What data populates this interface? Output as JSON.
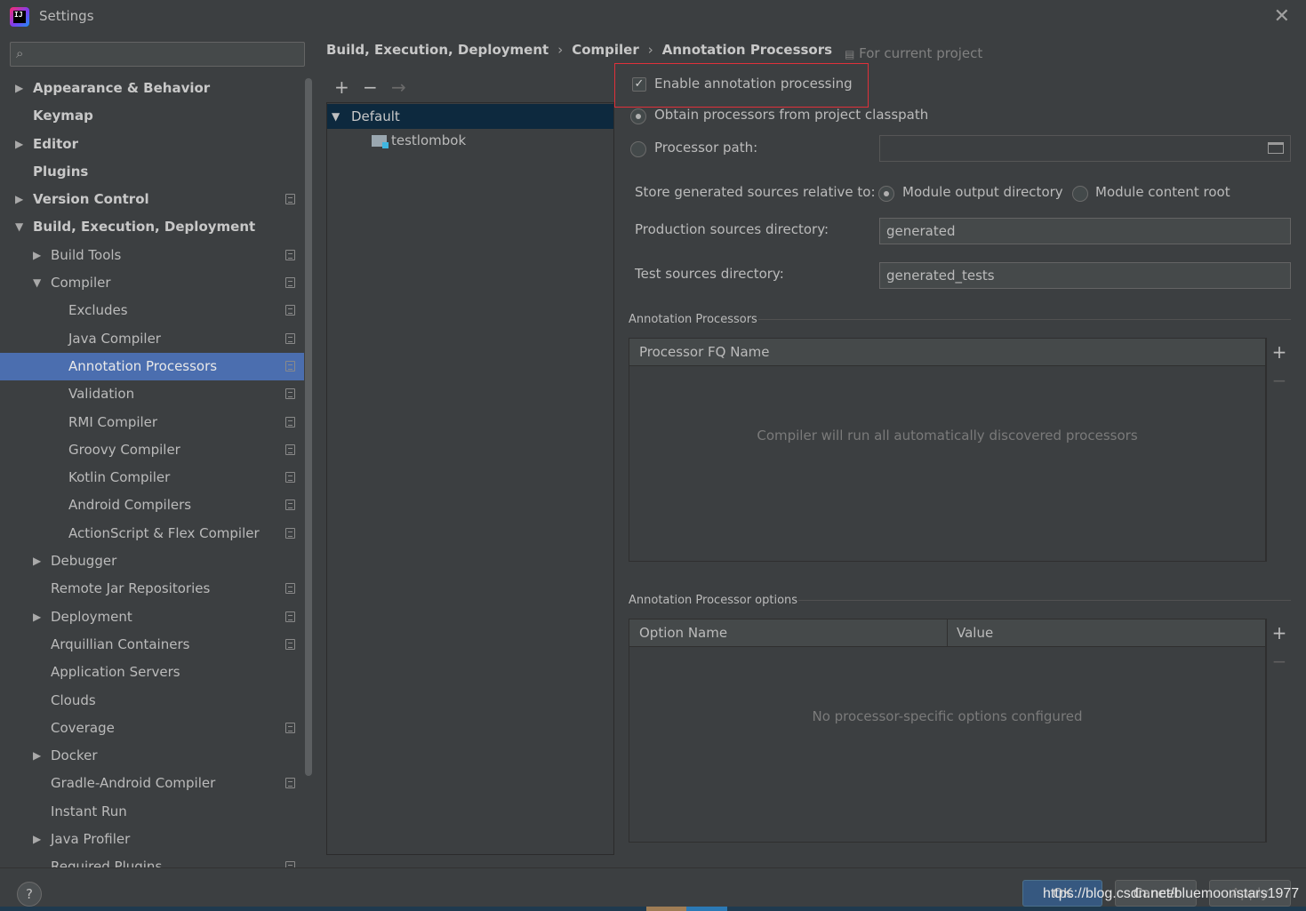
{
  "window": {
    "title": "Settings",
    "close_icon": "✕"
  },
  "search": {
    "placeholder": ""
  },
  "sidebar": {
    "items": [
      {
        "label": "Appearance & Behavior",
        "level": 0,
        "arrow": "▶",
        "bold": true,
        "project": false
      },
      {
        "label": "Keymap",
        "level": 0,
        "arrow": "",
        "bold": true,
        "project": false
      },
      {
        "label": "Editor",
        "level": 0,
        "arrow": "▶",
        "bold": true,
        "project": false
      },
      {
        "label": "Plugins",
        "level": 0,
        "arrow": "",
        "bold": true,
        "project": false
      },
      {
        "label": "Version Control",
        "level": 0,
        "arrow": "▶",
        "bold": true,
        "project": true
      },
      {
        "label": "Build, Execution, Deployment",
        "level": 0,
        "arrow": "▼",
        "bold": true,
        "project": false
      },
      {
        "label": "Build Tools",
        "level": 1,
        "arrow": "▶",
        "project": true
      },
      {
        "label": "Compiler",
        "level": 1,
        "arrow": "▼",
        "project": true
      },
      {
        "label": "Excludes",
        "level": 2,
        "arrow": "",
        "project": true
      },
      {
        "label": "Java Compiler",
        "level": 2,
        "arrow": "",
        "project": true
      },
      {
        "label": "Annotation Processors",
        "level": 2,
        "arrow": "",
        "project": true,
        "selected": true
      },
      {
        "label": "Validation",
        "level": 2,
        "arrow": "",
        "project": true
      },
      {
        "label": "RMI Compiler",
        "level": 2,
        "arrow": "",
        "project": true
      },
      {
        "label": "Groovy Compiler",
        "level": 2,
        "arrow": "",
        "project": true
      },
      {
        "label": "Kotlin Compiler",
        "level": 2,
        "arrow": "",
        "project": true
      },
      {
        "label": "Android Compilers",
        "level": 2,
        "arrow": "",
        "project": true
      },
      {
        "label": "ActionScript & Flex Compiler",
        "level": 2,
        "arrow": "",
        "project": true
      },
      {
        "label": "Debugger",
        "level": 1,
        "arrow": "▶",
        "project": false
      },
      {
        "label": "Remote Jar Repositories",
        "level": 1,
        "arrow": "",
        "project": true
      },
      {
        "label": "Deployment",
        "level": 1,
        "arrow": "▶",
        "project": true
      },
      {
        "label": "Arquillian Containers",
        "level": 1,
        "arrow": "",
        "project": true
      },
      {
        "label": "Application Servers",
        "level": 1,
        "arrow": "",
        "project": false
      },
      {
        "label": "Clouds",
        "level": 1,
        "arrow": "",
        "project": false
      },
      {
        "label": "Coverage",
        "level": 1,
        "arrow": "",
        "project": true
      },
      {
        "label": "Docker",
        "level": 1,
        "arrow": "▶",
        "project": false
      },
      {
        "label": "Gradle-Android Compiler",
        "level": 1,
        "arrow": "",
        "project": true
      },
      {
        "label": "Instant Run",
        "level": 1,
        "arrow": "",
        "project": false
      },
      {
        "label": "Java Profiler",
        "level": 1,
        "arrow": "▶",
        "project": false
      },
      {
        "label": "Required Plugins",
        "level": 1,
        "arrow": "",
        "project": true
      }
    ]
  },
  "breadcrumb": {
    "part1": "Build, Execution, Deployment",
    "part2": "Compiler",
    "part3": "Annotation Processors",
    "separator": "›"
  },
  "scope_note": "For current project",
  "profiles": {
    "toolbar": {
      "add": "+",
      "remove": "−",
      "move": "→"
    },
    "default_label": "Default",
    "module_label": "testlombok"
  },
  "settings": {
    "enable_label": "Enable annotation processing",
    "enable_checked": true,
    "obtain_label": "Obtain processors from project classpath",
    "processor_path_label": "Processor path:",
    "processor_path_value": "",
    "store_label": "Store generated sources relative to:",
    "module_output_label": "Module output directory",
    "module_content_label": "Module content root",
    "production_label": "Production sources directory:",
    "production_value": "generated",
    "test_label": "Test sources directory:",
    "test_value": "generated_tests"
  },
  "processors_section": {
    "title": "Annotation Processors",
    "column": "Processor FQ Name",
    "empty_text": "Compiler will run all automatically discovered processors"
  },
  "options_section": {
    "title": "Annotation Processor options",
    "col_name": "Option Name",
    "col_value": "Value",
    "empty_text": "No processor-specific options configured"
  },
  "side_tools": {
    "add": "+",
    "remove": "−"
  },
  "footer": {
    "help": "?",
    "ok": "OK",
    "cancel": "Cancel",
    "apply": "Apply",
    "watermark": "https://blog.csdn.net/bluemoonstars1977"
  }
}
